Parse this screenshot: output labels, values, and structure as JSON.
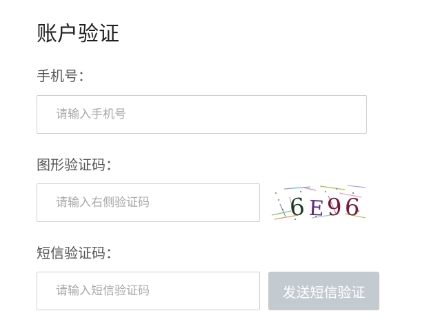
{
  "page_title": "账户验证",
  "phone": {
    "label": "手机号：",
    "placeholder": "请输入手机号",
    "value": ""
  },
  "captcha": {
    "label": "图形验证码：",
    "placeholder": "请输入右侧验证码",
    "value": "",
    "image_text": [
      "6",
      "E",
      "9",
      "6"
    ],
    "char_colors": [
      "#1d3b24",
      "#5b2a86",
      "#7a1636",
      "#7a1636"
    ]
  },
  "sms": {
    "label": "短信验证码：",
    "placeholder": "请输入短信验证码",
    "value": "",
    "send_button_label": "发送短信验证",
    "send_button_color": "#c3cbd0"
  }
}
